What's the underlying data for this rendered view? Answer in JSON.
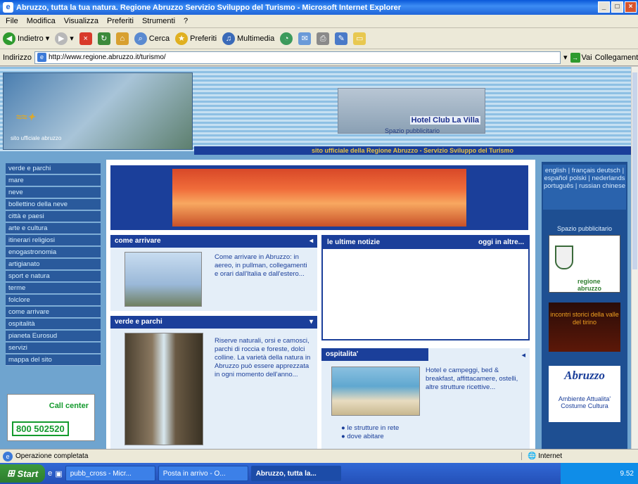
{
  "window": {
    "title": "Abruzzo, tutta la tua natura. Regione Abruzzo Servizio Sviluppo del Turismo - Microsoft Internet Explorer"
  },
  "menu": [
    "File",
    "Modifica",
    "Visualizza",
    "Preferiti",
    "Strumenti",
    "?"
  ],
  "toolbar": {
    "back": "Indietro",
    "search": "Cerca",
    "favorites": "Preferiti",
    "media": "Multimedia"
  },
  "address": {
    "label": "Indirizzo",
    "url": "http://www.regione.abruzzo.it/turismo/",
    "go": "Vai",
    "links": "Collegamenti"
  },
  "header": {
    "logo_sub": "sito ufficiale abruzzo",
    "ad_hotel": "Hotel Club La Villa",
    "ad_label": "Spazio pubblicitario",
    "site_bar": "sito ufficiale della Regione Abruzzo - Servizio Sviluppo del Turismo"
  },
  "nav": [
    "verde e parchi",
    "mare",
    "neve",
    "bollettino della neve",
    "città e paesi",
    "arte e cultura",
    "itinerari religiosi",
    "enogastronomia",
    "artigianato",
    "sport e natura",
    "terme",
    "folclore",
    "come arrivare",
    "ospitalità",
    "pianeta Eurosud",
    "servizi",
    "mappa del sito"
  ],
  "callcenter": {
    "title": "Call center",
    "number": "800 502520"
  },
  "boxes": {
    "come_arrivare": {
      "title": "come arrivare",
      "text": "Come arrivare in Abruzzo: in aereo, in pullman, collegamenti e orari dall'Italia e dall'estero..."
    },
    "verde_parchi": {
      "title": "verde e parchi",
      "text": "Riserve naturali, orsi e camosci, parchi di roccia e foreste, dolci colline. La varietà della natura in Abruzzo può essere apprezzata in ogni momento dell'anno..."
    },
    "news": {
      "title": "le ultime notizie",
      "link": "oggi in altre..."
    },
    "ospitalita": {
      "title": "ospitalita'",
      "text": "Hotel e campeggi, bed & breakfast, affittacamere, ostelli, altre strutture ricettive...",
      "items": [
        "le strutture in rete",
        "dove abitare"
      ]
    }
  },
  "right": {
    "languages": "english | français deutsch | español polski | nederlands português | russian chinese",
    "spazio": "Spazio pubblicitario",
    "ad1": "regione abruzzo",
    "ad2": "incontri storici della valle del tirino",
    "ad3_title": "Abruzzo",
    "ad3_sub": "Ambiente Attualita' Costume Cultura"
  },
  "status": {
    "text": "Operazione completata",
    "zone": "Internet"
  },
  "taskbar": {
    "start": "Start",
    "tasks": [
      "pubb_cross - Micr...",
      "Posta in arrivo - O...",
      "Abruzzo, tutta la..."
    ],
    "clock": "9.52"
  },
  "colors": {
    "nav_bg": "#2a5a9c",
    "title_bar": "#1b3f9a",
    "accent": "#e8c040"
  }
}
